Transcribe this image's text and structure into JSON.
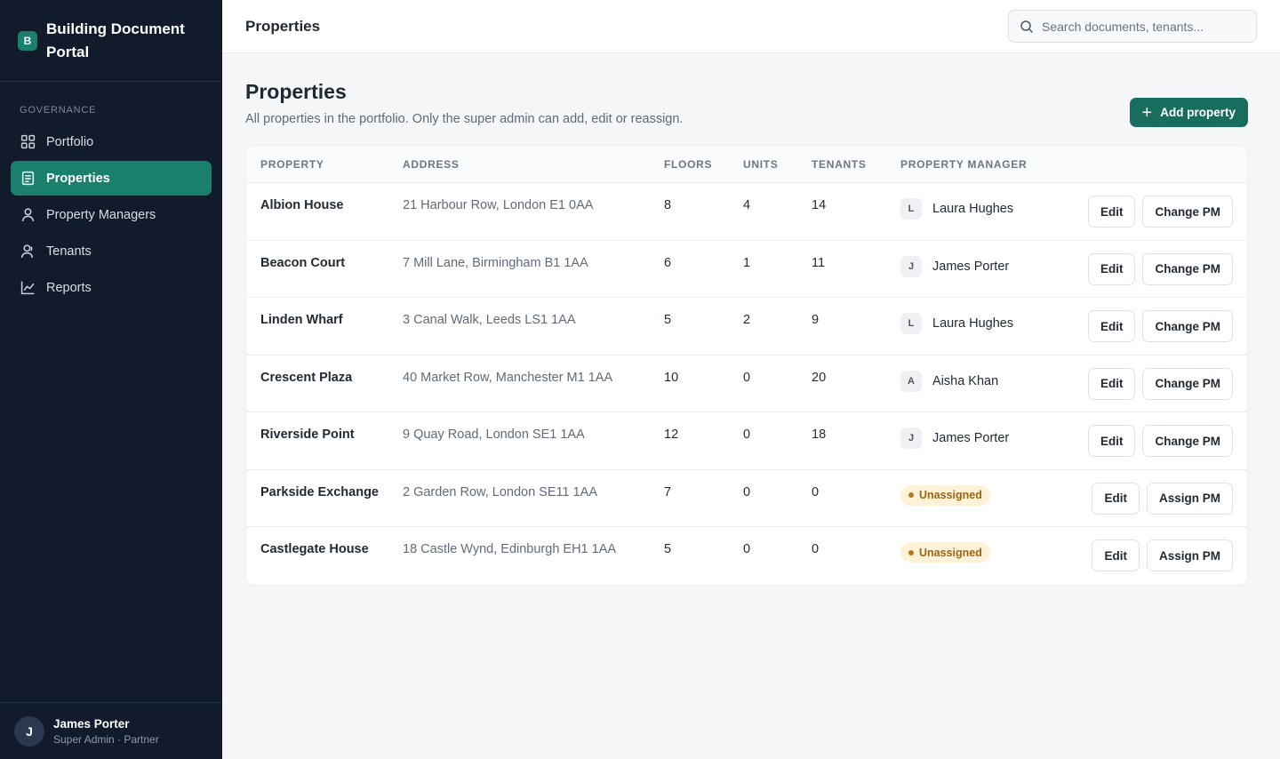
{
  "sidebar": {
    "brand_initial": "B",
    "brand_title": "Building Document Portal",
    "section_label": "GOVERNANCE",
    "items": [
      {
        "label": "Portfolio",
        "icon": "grid-icon"
      },
      {
        "label": "Properties",
        "icon": "document-icon",
        "active": true
      },
      {
        "label": "Property Managers",
        "icon": "user-icon"
      },
      {
        "label": "Tenants",
        "icon": "person-icon"
      },
      {
        "label": "Reports",
        "icon": "chart-icon"
      }
    ],
    "user": {
      "initial": "J",
      "name": "James Porter",
      "role": "Super Admin · Partner"
    }
  },
  "topbar": {
    "title": "Properties",
    "search_placeholder": "Search documents, tenants..."
  },
  "page": {
    "title": "Properties",
    "subtitle": "All properties in the portfolio. Only the super admin can add, edit or reassign.",
    "add_button": "Add property"
  },
  "table": {
    "headers": {
      "property": "PROPERTY",
      "address": "ADDRESS",
      "floors": "FLOORS",
      "units": "UNITS",
      "tenants": "TENANTS",
      "pm": "PROPERTY MANAGER"
    },
    "rows": [
      {
        "property": "Albion House",
        "address": "21 Harbour Row, London E1 0AA",
        "floors": "8",
        "units": "4",
        "tenants": "14",
        "pm_initial": "L",
        "pm": "Laura Hughes",
        "edit": "Edit",
        "action": "Change PM"
      },
      {
        "property": "Beacon Court",
        "address": "7 Mill Lane, Birmingham B1 1AA",
        "floors": "6",
        "units": "1",
        "tenants": "11",
        "pm_initial": "J",
        "pm": "James Porter",
        "edit": "Edit",
        "action": "Change PM"
      },
      {
        "property": "Linden Wharf",
        "address": "3 Canal Walk, Leeds LS1 1AA",
        "floors": "5",
        "units": "2",
        "tenants": "9",
        "pm_initial": "L",
        "pm": "Laura Hughes",
        "edit": "Edit",
        "action": "Change PM"
      },
      {
        "property": "Crescent Plaza",
        "address": "40 Market Row, Manchester M1 1AA",
        "floors": "10",
        "units": "0",
        "tenants": "20",
        "pm_initial": "A",
        "pm": "Aisha Khan",
        "edit": "Edit",
        "action": "Change PM"
      },
      {
        "property": "Riverside Point",
        "address": "9 Quay Road, London SE1 1AA",
        "floors": "12",
        "units": "0",
        "tenants": "18",
        "pm_initial": "J",
        "pm": "James Porter",
        "edit": "Edit",
        "action": "Change PM"
      },
      {
        "property": "Parkside Exchange",
        "address": "2 Garden Row, London SE11 1AA",
        "floors": "7",
        "units": "0",
        "tenants": "0",
        "pm_status": "Unassigned",
        "edit": "Edit",
        "action": "Assign PM"
      },
      {
        "property": "Castlegate House",
        "address": "18 Castle Wynd, Edinburgh EH1 1AA",
        "floors": "5",
        "units": "0",
        "tenants": "0",
        "pm_status": "Unassigned",
        "edit": "Edit",
        "action": "Assign PM"
      }
    ]
  },
  "colors": {
    "sidebar_bg": "#121b2b",
    "accent": "#1a7f6d",
    "primary_button": "#176e5f",
    "unassigned_badge_bg": "#fdf2d8",
    "unassigned_badge_text": "#9a6412"
  }
}
